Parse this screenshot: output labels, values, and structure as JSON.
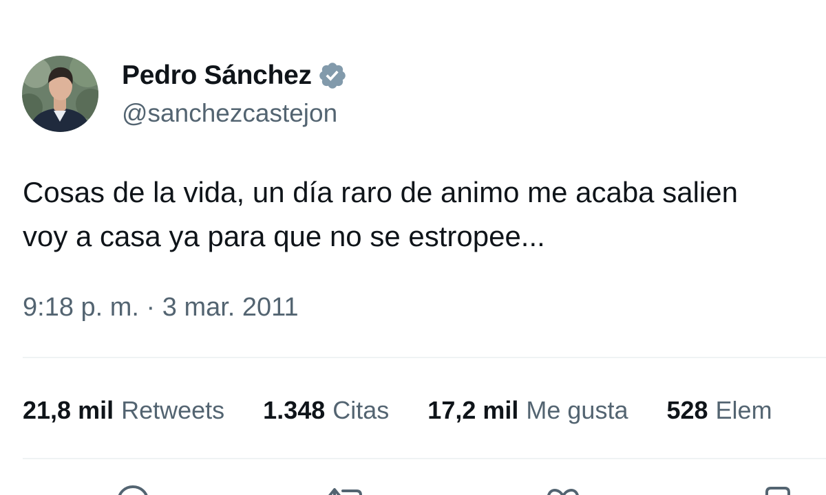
{
  "header": {
    "avatar_icon": "avatar-photo",
    "display_name": "Pedro Sánchez",
    "verified_icon": "verified-badge-icon",
    "verified_color": "#829aab",
    "handle": "@sanchezcastejon"
  },
  "tweet": {
    "lines": [
      "Cosas de la vida, un día raro de animo me acaba salien",
      "voy a casa ya para que no se estropee..."
    ],
    "timestamp": "9:18 p. m. · 3 mar. 2011"
  },
  "stats": {
    "retweets": {
      "value": "21,8 mil",
      "label": "Retweets"
    },
    "quotes": {
      "value": "1.348",
      "label": "Citas"
    },
    "likes": {
      "value": "17,2 mil",
      "label": "Me gusta"
    },
    "bookmarks": {
      "value": "528",
      "label": "Elem"
    }
  },
  "actions": {
    "icons": [
      "reply-icon",
      "retweet-icon",
      "like-icon",
      "bookmark-icon"
    ]
  },
  "colors": {
    "text_primary": "#0f1419",
    "text_secondary": "#536471",
    "divider": "#eff3f4"
  }
}
